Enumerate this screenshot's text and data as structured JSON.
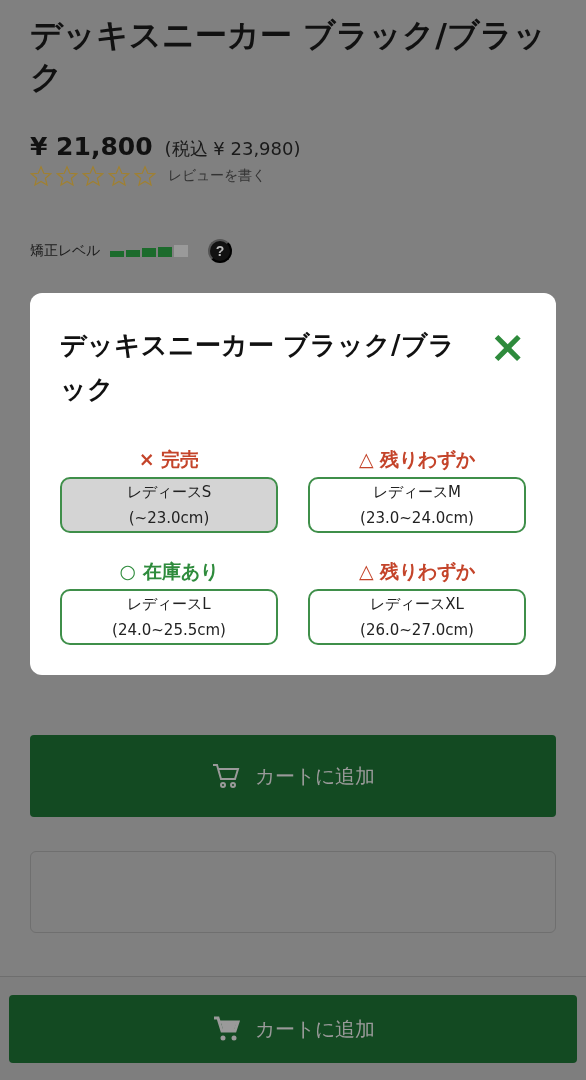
{
  "product": {
    "title": "デッキスニーカー ブラック/ブラック",
    "price": "¥ 21,800",
    "tax_included": "(税込 ¥ 23,980)",
    "stars": 0,
    "review_link": "レビューを書く",
    "correction_label": "矯正レベル",
    "correction_meter": {
      "level": 0.8
    },
    "help": "?"
  },
  "add_to_cart": {
    "label": "カートに追加"
  },
  "sticky_bar": {
    "label": "カートに追加"
  },
  "size_dialog": {
    "title": "デッキスニーカー ブラック/ブラック",
    "close": "×",
    "sizes": [
      {
        "status": "× 完売",
        "kind": "soldout",
        "name": "レディースS",
        "range": "(~23.0cm)",
        "disabled": true
      },
      {
        "status": "△ 残りわずか",
        "kind": "few",
        "name": "レディースM",
        "range": "(23.0~24.0cm)",
        "disabled": false
      },
      {
        "status": "○ 在庫あり",
        "kind": "instock",
        "name": "レディースL",
        "range": "(24.0~25.5cm)",
        "disabled": false
      },
      {
        "status": "△ 残りわずか",
        "kind": "few",
        "name": "レディースXL",
        "range": "(26.0~27.0cm)",
        "disabled": false
      }
    ]
  }
}
